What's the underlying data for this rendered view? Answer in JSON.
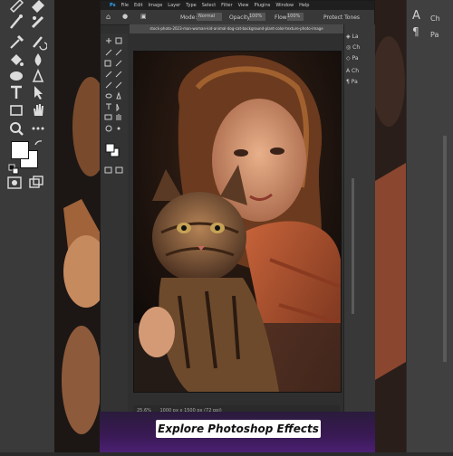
{
  "menu": [
    "Ps",
    "File",
    "Edit",
    "Image",
    "Layer",
    "Type",
    "Select",
    "Filter",
    "View",
    "Plugins",
    "Window",
    "Help"
  ],
  "options": {
    "mode_label": "Mode:",
    "mode_value": "Normal",
    "opacity_label": "Opacity:",
    "opacity_value": "100%",
    "flow_label": "Flow:",
    "flow_value": "100%",
    "protect_label": "Protect Tones"
  },
  "document_tab": "stock-photo-2023-man-woman-kid-animal-dog-cat-background-plant-color-texture-photo-image",
  "status": {
    "zoom": "25.6%",
    "dimensions": "1000 px x 1500 px (72 ppi)"
  },
  "right_panel_small": [
    "La",
    "Ch",
    "Pa",
    "Ch",
    "Pa"
  ],
  "right_panel_big": [
    "A",
    "Ch",
    "Pa"
  ],
  "caption": "Explore Photoshop Effects",
  "colors": {
    "accent": "#4b1f73",
    "caption_bg": "#ffffff"
  }
}
